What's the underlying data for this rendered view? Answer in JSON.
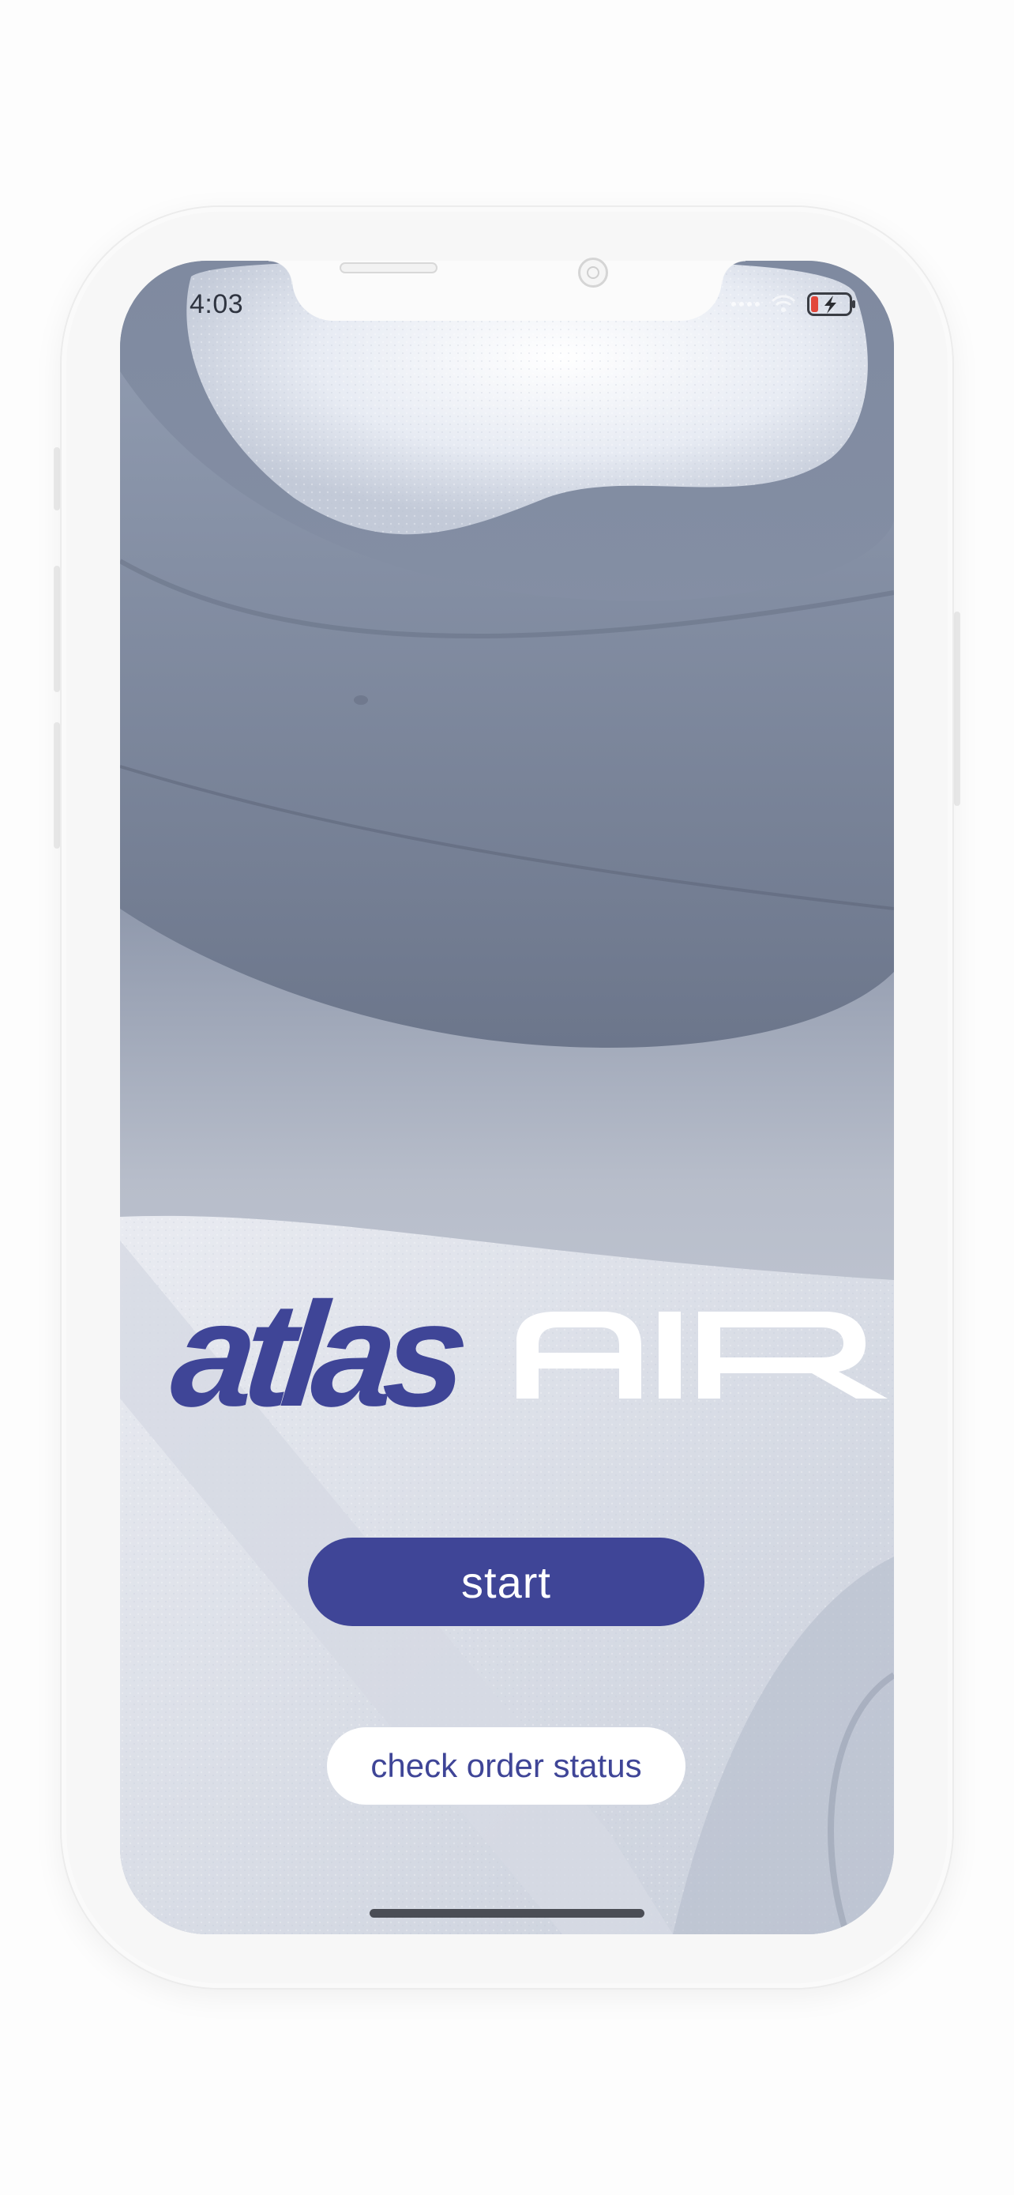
{
  "status_bar": {
    "time": "4:03"
  },
  "logo": {
    "brand_primary": "atlas",
    "brand_secondary": "AIR",
    "primary_color": "#3f4597",
    "secondary_color": "#ffffff"
  },
  "actions": {
    "start_label": "start",
    "check_status_label": "check order status"
  },
  "icons": {
    "wifi": "wifi-icon",
    "battery": "battery-charging-icon",
    "signal": "cellular-signal-icon"
  },
  "colors": {
    "accent": "#3f4597",
    "button_text_light": "#ffffff"
  }
}
